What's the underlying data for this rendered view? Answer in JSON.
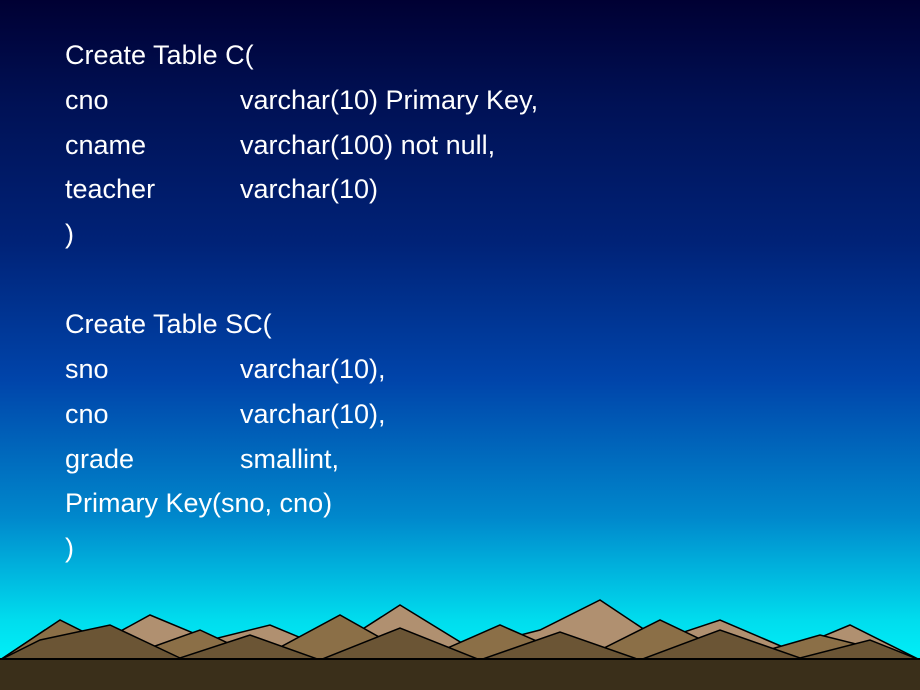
{
  "slide": {
    "block1": {
      "line1": "Create Table C(",
      "row1_col": "cno",
      "row1_def": "varchar(10) Primary Key,",
      "row2_col": "cname",
      "row2_def": "varchar(100) not null,",
      "row3_col": "teacher",
      "row3_def": "varchar(10)",
      "line5": ")"
    },
    "block2": {
      "line1": "Create Table SC(",
      "row1_col": "sno",
      "row1_def": "varchar(10),",
      "row2_col": "cno",
      "row2_def": "varchar(10),",
      "row3_col": "grade",
      "row3_def": "smallint,",
      "line5": "Primary Key(sno, cno)",
      "line6": ")"
    }
  }
}
